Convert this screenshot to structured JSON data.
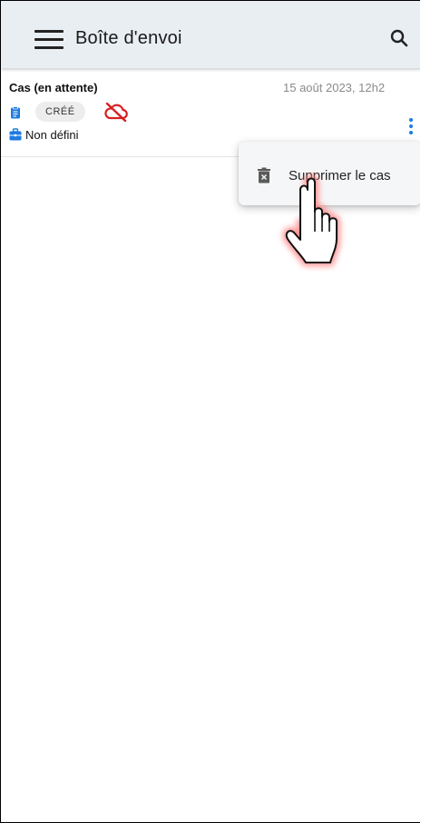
{
  "appbar": {
    "title": "Boîte d'envoi",
    "menu_icon": "hamburger-menu-icon",
    "search_icon": "search-icon"
  },
  "case": {
    "title": "Cas (en attente)",
    "date": "15 août 2023, 12h2",
    "status": "CRÉÉ",
    "assignment": "Non défini",
    "icons": {
      "document": "clipboard-icon",
      "sync": "cloud-off-icon",
      "assignment": "briefcase-icon",
      "more": "more-vertical-icon"
    }
  },
  "context_menu": {
    "items": [
      {
        "label": "Supprimer le cas",
        "icon": "trash-icon"
      }
    ]
  },
  "colors": {
    "appbar_bg": "#e9eef3",
    "accent_blue": "#1e7be0",
    "cloud_red": "#d62020",
    "badge_bg": "#ededed",
    "menu_bg": "#f5f6f7",
    "date_gray": "#8a8a8a"
  },
  "overlay": {
    "pointer": "hand-pointer-icon"
  }
}
